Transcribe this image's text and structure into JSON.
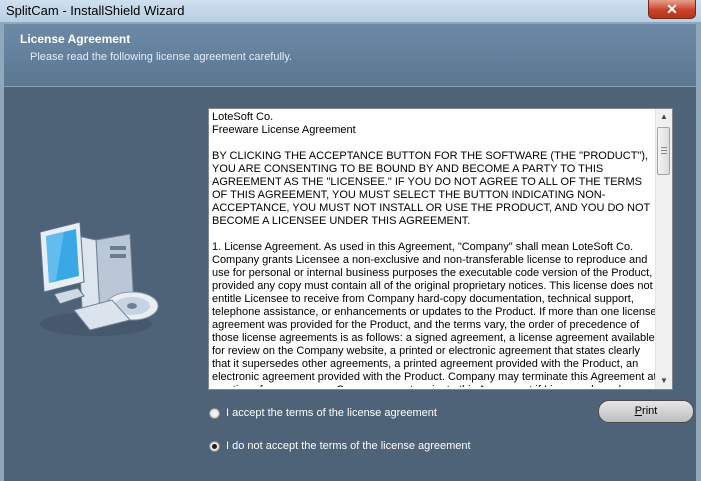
{
  "window": {
    "title": "SplitCam - InstallShield Wizard",
    "close_glyph": "✕"
  },
  "header": {
    "title": "License Agreement",
    "subtitle": "Please read the following license agreement carefully."
  },
  "license": {
    "text": "LoteSoft Co.\nFreeware License Agreement\n\nBY CLICKING THE ACCEPTANCE BUTTON FOR THE SOFTWARE (THE \"PRODUCT\"), YOU ARE CONSENTING TO BE BOUND BY AND BECOME A PARTY TO THIS AGREEMENT AS THE \"LICENSEE.\" IF YOU DO NOT AGREE TO ALL OF THE TERMS OF THIS AGREEMENT, YOU MUST SELECT THE BUTTON INDICATING NON-ACCEPTANCE, YOU MUST NOT INSTALL OR USE THE PRODUCT, AND YOU DO NOT BECOME A LICENSEE UNDER THIS AGREEMENT.\n\n1. License Agreement. As used in this Agreement, \"Company\" shall mean LoteSoft Co. Company grants Licensee a non-exclusive and non-transferable license to reproduce and use for personal or internal business purposes the executable code version of the Product, provided any copy must contain all of the original proprietary notices. This license does not entitle Licensee to receive from Company hard-copy documentation, technical support, telephone assistance, or enhancements or updates to the Product. If more than one license agreement was provided for the Product, and the terms vary, the order of precedence of those license agreements is as follows: a signed agreement, a license agreement available for review on the Company website, a printed or electronic agreement that states clearly that it supersedes other agreements, a printed agreement provided with the Product, an electronic agreement provided with the Product. Company may terminate this Agreement at any time, for any reason. Company may terminate this Agreement if Licensee breaches any"
  },
  "options": {
    "accept_label": "I accept the terms of the license agreement",
    "decline_label": "I do not accept the terms of the license agreement",
    "selected": "decline"
  },
  "buttons": {
    "print_prefix": "",
    "print_mnemonic": "P",
    "print_rest": "rint"
  },
  "colors": {
    "dialog_bg": "#4e6378",
    "header_bg": "#5b7792"
  }
}
